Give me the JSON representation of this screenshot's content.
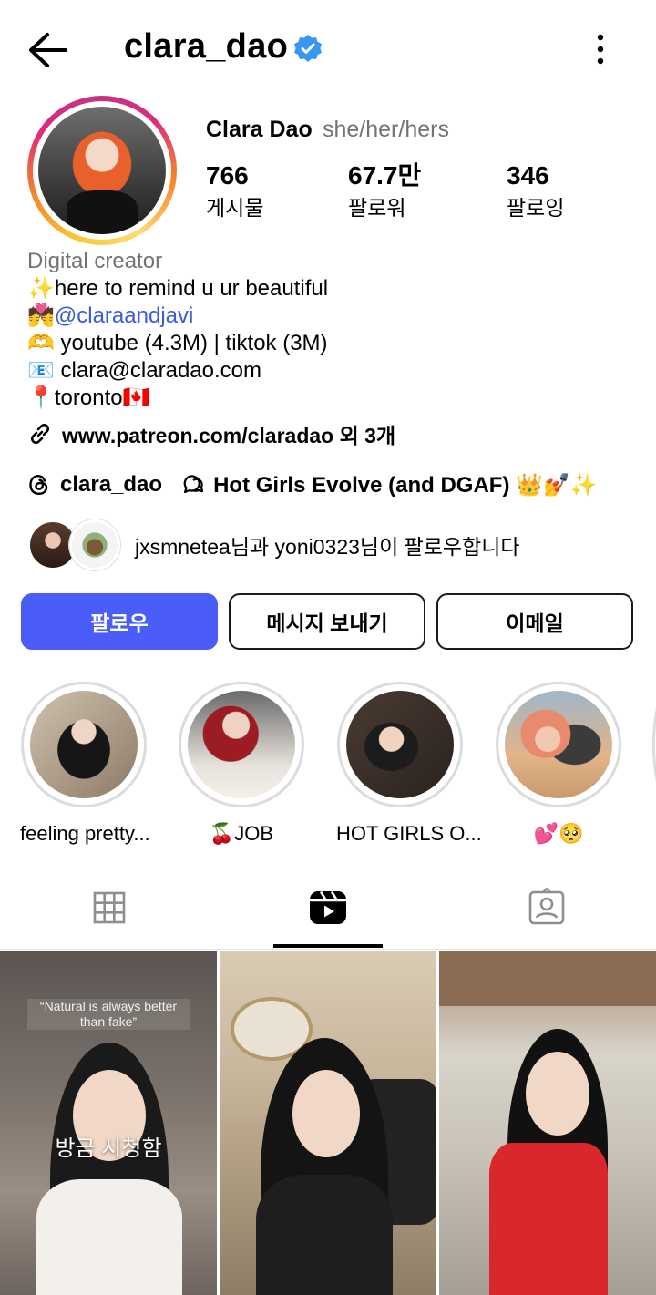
{
  "header": {
    "username": "clara_dao",
    "back_icon": "arrow-left-icon",
    "verified_icon": "verified-badge-icon",
    "verified_color": "#3897f0",
    "more_icon": "more-vertical-icon"
  },
  "profile": {
    "display_name": "Clara Dao",
    "pronouns": "she/her/hers",
    "stats": [
      {
        "value": "766",
        "label": "게시물"
      },
      {
        "value": "67.7만",
        "label": "팔로워"
      },
      {
        "value": "346",
        "label": "팔로잉"
      }
    ]
  },
  "bio": {
    "category": "Digital creator",
    "line1": "✨here to remind u ur beautiful",
    "line2_emoji": "💏",
    "line2_mention": "@claraandjavi",
    "line3": "🫶 youtube (4.3M) | tiktok (3M)",
    "line4": "📧 clara@claradao.com",
    "line5": "📍toronto🇨🇦",
    "link": "www.patreon.com/claradao 외 3개"
  },
  "threads": {
    "handle": "clara_dao",
    "channel": "Hot Girls Evolve (and DGAF) 👑💅✨"
  },
  "mutual": {
    "user1": "jxsmnetea",
    "mid": "님과 ",
    "user2": "yoni0323",
    "tail": "님이 팔로우합니다"
  },
  "buttons": {
    "follow": "팔로우",
    "message": "메시지 보내기",
    "email": "이메일",
    "follow_color": "#4a5df9"
  },
  "highlights": [
    {
      "label": "feeling pretty..."
    },
    {
      "label": "🍒JOB"
    },
    {
      "label": "HOT GIRLS O..."
    },
    {
      "label": "💕🥺"
    }
  ],
  "tabs": {
    "grid": "grid-icon",
    "reels": "reels-icon",
    "tagged": "tagged-icon",
    "active": "reels"
  },
  "reels": [
    {
      "caption": "“Natural is always better than fake”",
      "overlay": "방금 시청함"
    },
    {
      "caption": "",
      "overlay": ""
    },
    {
      "caption": "",
      "overlay": ""
    }
  ]
}
